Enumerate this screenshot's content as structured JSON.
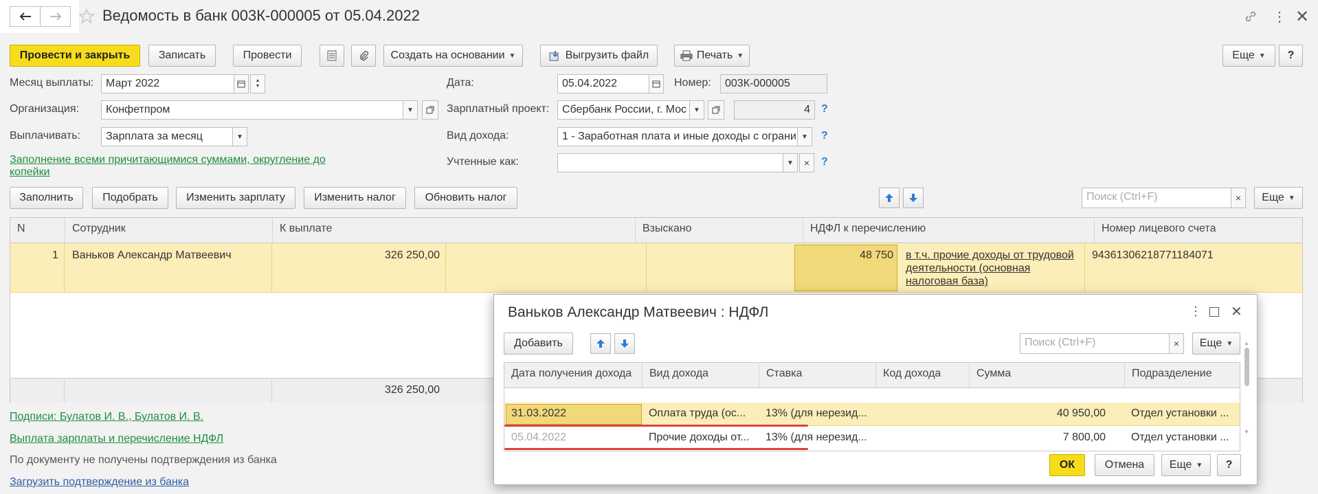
{
  "window": {
    "title": "Ведомость в банк 003К-000005 от 05.04.2022",
    "back_icon": "arrow-left-icon",
    "forward_icon": "arrow-right-icon",
    "star_icon": "star-icon"
  },
  "toolbar": {
    "post_close": "Провести и закрыть",
    "save": "Записать",
    "post": "Провести",
    "create_based": "Создать на основании",
    "export_file": "Выгрузить файл",
    "print": "Печать",
    "more": "Еще",
    "help": "?"
  },
  "form": {
    "month_label": "Месяц выплаты:",
    "month_value": "Март 2022",
    "date_label": "Дата:",
    "date_value": "05.04.2022",
    "number_label": "Номер:",
    "number_value": "003К-000005",
    "org_label": "Организация:",
    "org_value": "Конфетпром",
    "salary_project_label": "Зарплатный проект:",
    "salary_project_value": "Сбербанк России, г. Мос",
    "salary_project_count": "4",
    "pay_label": "Выплачивать:",
    "pay_value": "Зарплата за месяц",
    "income_type_label": "Вид дохода:",
    "income_type_value": "1 - Заработная плата и иные доходы с ограни",
    "counted_as_label": "Учтенные как:",
    "counted_as_value": "",
    "fill_link_line1": "Заполнение всеми причитающимися суммами, округление до",
    "fill_link_line2": "копейки",
    "q": "?"
  },
  "table_toolbar": {
    "fill": "Заполнить",
    "pick": "Подобрать",
    "change_salary": "Изменить зарплату",
    "change_tax": "Изменить налог",
    "update_tax": "Обновить налог",
    "search_placeholder": "Поиск (Ctrl+F)",
    "clear": "×",
    "more": "Еще"
  },
  "table": {
    "headers": [
      "N",
      "Сотрудник",
      "К выплате",
      "Взыскано",
      "НДФЛ к перечислению",
      "Номер лицевого счета"
    ],
    "row": {
      "n": "1",
      "employee": "Ваньков Александр Матвеевич",
      "to_pay": "326 250,00",
      "collected": "",
      "ndfl": "48 750",
      "ndfl_note_1": "в т.ч. прочие доходы от трудовой",
      "ndfl_note_2": "деятельности (основная",
      "ndfl_note_3": "налоговая база)",
      "account": "94361306218771184071"
    },
    "total": "326 250,00"
  },
  "footer": {
    "signatures": "Подписи: Булатов И. В., Булатов И. В.",
    "payout_link": "Выплата зарплаты и перечисление НДФЛ",
    "status_text": "По документу не получены подтверждения из банка",
    "load_link": "Загрузить подтверждение из банка"
  },
  "dialog": {
    "title": "Ваньков Александр Матвеевич : НДФЛ",
    "add": "Добавить",
    "search_placeholder": "Поиск (Ctrl+F)",
    "clear": "×",
    "more": "Еще",
    "headers": [
      "Дата получения дохода",
      "Вид дохода",
      "Ставка",
      "Код дохода",
      "Сумма",
      "Подразделение"
    ],
    "rows": [
      {
        "date": "31.03.2022",
        "kind": "Оплата труда (ос...",
        "rate": "13% (для нерезид...",
        "code": "",
        "sum": "40 950,00",
        "dept": "Отдел установки ..."
      },
      {
        "date": "05.04.2022",
        "kind": "Прочие доходы от...",
        "rate": "13% (для нерезид...",
        "code": "",
        "sum": "7 800,00",
        "dept": "Отдел установки ..."
      }
    ],
    "ok": "ОК",
    "cancel": "Отмена",
    "help": "?"
  },
  "colors": {
    "accent": "#f7dc1c",
    "selected_row": "#fbeeb8",
    "link_green": "#1e8f3f",
    "underline_red": "#e0403a"
  }
}
